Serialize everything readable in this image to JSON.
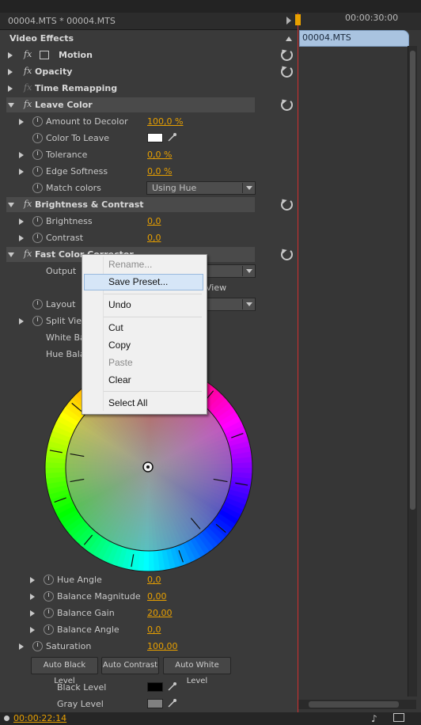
{
  "header": {
    "title": "00004.MTS * 00004.MTS"
  },
  "timeline": {
    "time_marker": "00:00:30:00",
    "clip_name": "00004.MTS"
  },
  "panel": {
    "title": "Video Effects"
  },
  "effects": {
    "motion": "Motion",
    "opacity": "Opacity",
    "time_remapping": "Time Remapping",
    "fx": "fx",
    "leave_color": {
      "title": "Leave Color",
      "amount_label": "Amount to Decolor",
      "amount_value": "100,0 %",
      "color_label": "Color To Leave",
      "color_value": "#ffffff",
      "tolerance_label": "Tolerance",
      "tolerance_value": "0,0 %",
      "edge_label": "Edge Softness",
      "edge_value": "0,0 %",
      "match_label": "Match colors",
      "match_value": "Using Hue"
    },
    "brightness_contrast": {
      "title": "Brightness & Contrast",
      "brightness_label": "Brightness",
      "brightness_value": "0,0",
      "contrast_label": "Contrast",
      "contrast_value": "0,0"
    },
    "fast_color": {
      "title": "Fast Color Corrector",
      "output_label": "Output",
      "view_partial": "View",
      "layout_label": "Layout",
      "split_label": "Split View",
      "white_label": "White Balance",
      "hue_label": "Hue Balance",
      "hue_angle_label": "Hue Angle",
      "hue_angle_value": "0,0",
      "bal_mag_label": "Balance Magnitude",
      "bal_mag_value": "0,00",
      "bal_gain_label": "Balance Gain",
      "bal_gain_value": "20,00",
      "bal_angle_label": "Balance Angle",
      "bal_angle_value": "0,0",
      "saturation_label": "Saturation",
      "saturation_value": "100,00",
      "btn_auto_black": "Auto Black Level",
      "btn_auto_contrast": "Auto Contrast",
      "btn_auto_white": "Auto White Level",
      "black_label": "Black Level",
      "black_value": "#000000",
      "gray_label": "Gray Level",
      "gray_value": "#808080"
    }
  },
  "context_menu": {
    "rename": "Rename...",
    "save_preset": "Save Preset...",
    "undo": "Undo",
    "cut": "Cut",
    "copy": "Copy",
    "paste": "Paste",
    "clear": "Clear",
    "select_all": "Select All"
  },
  "status": {
    "timecode": "00:00:22:14"
  },
  "colors": {
    "accent": "#e8a000",
    "playhead": "#d03030",
    "clip": "#a9c3e0"
  }
}
